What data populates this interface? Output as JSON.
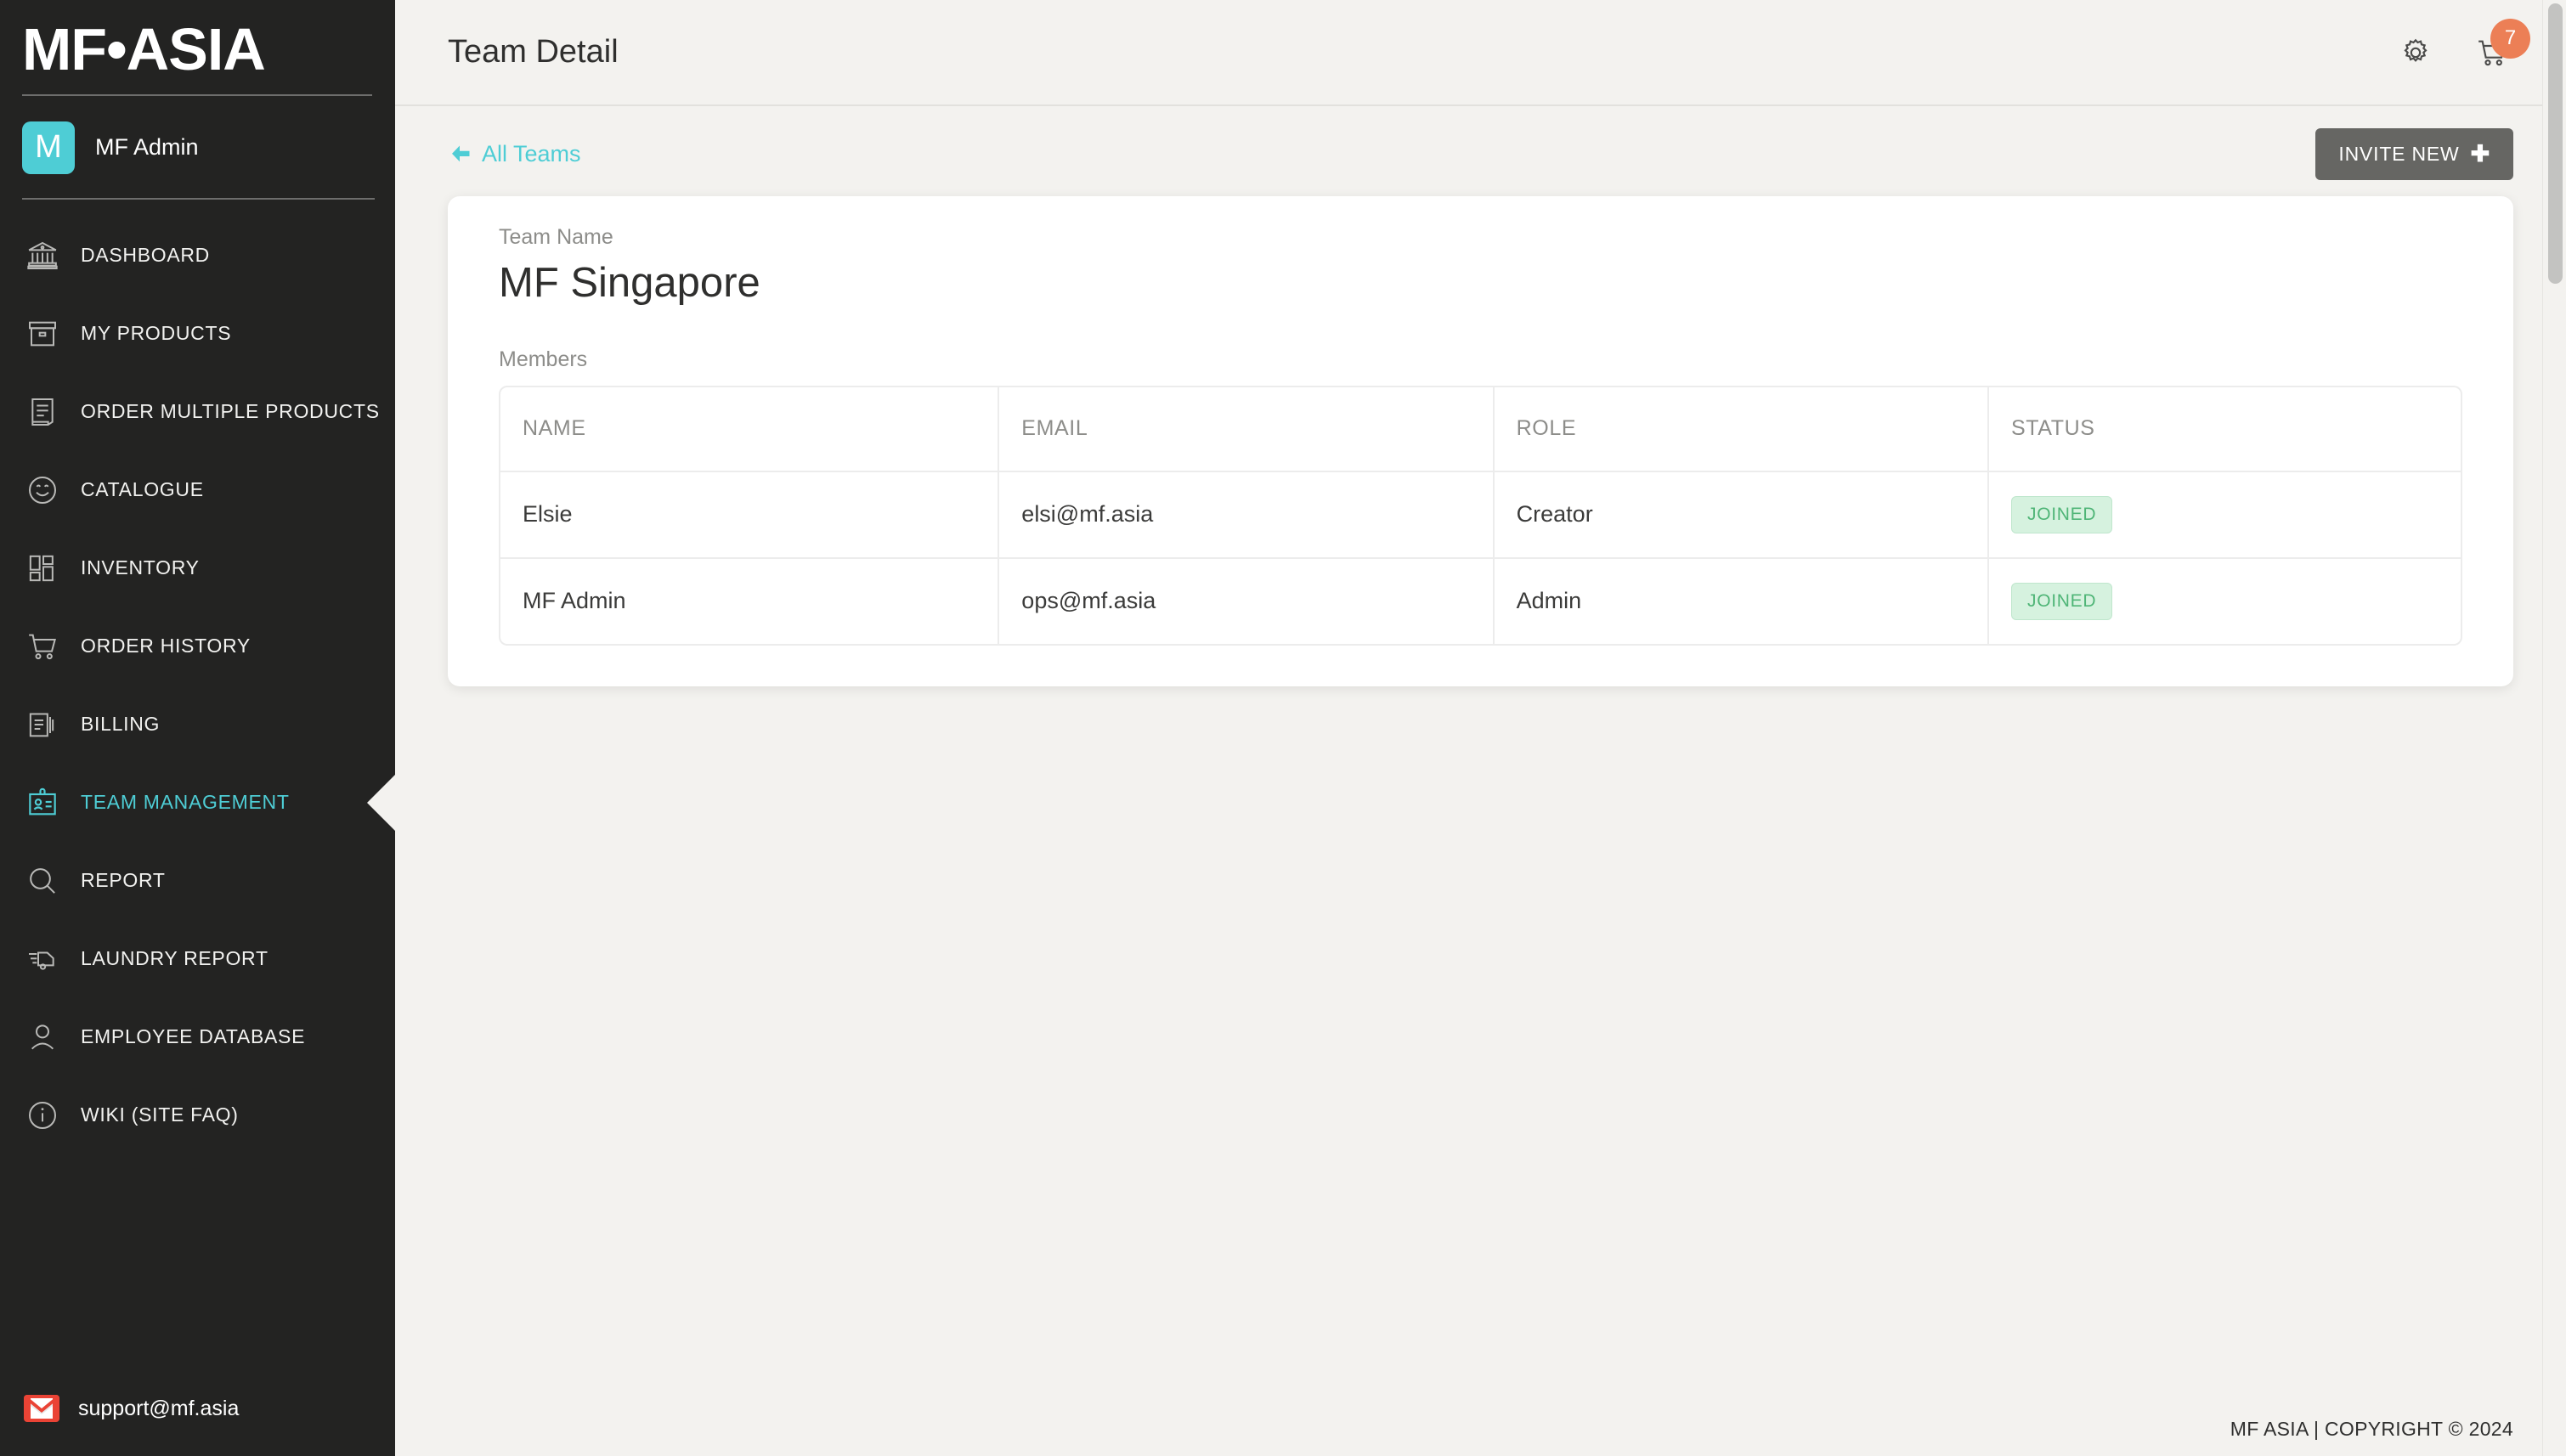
{
  "brand": {
    "logo": "MF•ASIA",
    "user_initial": "M",
    "user_name": "MF Admin",
    "accent_color": "#4ecdd5"
  },
  "sidebar": {
    "items": [
      {
        "label": "DASHBOARD",
        "icon": "bank-icon",
        "active": false
      },
      {
        "label": "MY PRODUCTS",
        "icon": "box-icon",
        "active": false
      },
      {
        "label": "ORDER MULTIPLE PRODUCTS",
        "icon": "receipt-icon",
        "active": false
      },
      {
        "label": "CATALOGUE",
        "icon": "smiley-icon",
        "active": false
      },
      {
        "label": "INVENTORY",
        "icon": "grid-icon",
        "active": false
      },
      {
        "label": "ORDER HISTORY",
        "icon": "cart-icon",
        "active": false
      },
      {
        "label": "BILLING",
        "icon": "documents-icon",
        "active": false
      },
      {
        "label": "TEAM MANAGEMENT",
        "icon": "id-badge-icon",
        "active": true
      },
      {
        "label": "REPORT",
        "icon": "magnifier-icon",
        "active": false
      },
      {
        "label": "LAUNDRY REPORT",
        "icon": "delivery-truck-icon",
        "active": false
      },
      {
        "label": "EMPLOYEE DATABASE",
        "icon": "person-icon",
        "active": false
      },
      {
        "label": "WIKI (SITE FAQ)",
        "icon": "info-circle-icon",
        "active": false
      }
    ],
    "support_email": "support@mf.asia"
  },
  "header": {
    "title": "Team Detail",
    "cart_count": "7"
  },
  "subbar": {
    "back_label": "All Teams",
    "invite_label": "INVITE NEW",
    "invite_plus": "✚"
  },
  "card": {
    "team_name_label": "Team Name",
    "team_name": "MF Singapore",
    "members_label": "Members",
    "table": {
      "columns": [
        "NAME",
        "EMAIL",
        "ROLE",
        "STATUS"
      ],
      "rows": [
        {
          "name": "Elsie",
          "email": "elsi@mf.asia",
          "role": "Creator",
          "status": "JOINED"
        },
        {
          "name": "MF Admin",
          "email": "ops@mf.asia",
          "role": "Admin",
          "status": "JOINED"
        }
      ]
    }
  },
  "footer": {
    "copyright": "MF ASIA | COPYRIGHT © 2024"
  }
}
